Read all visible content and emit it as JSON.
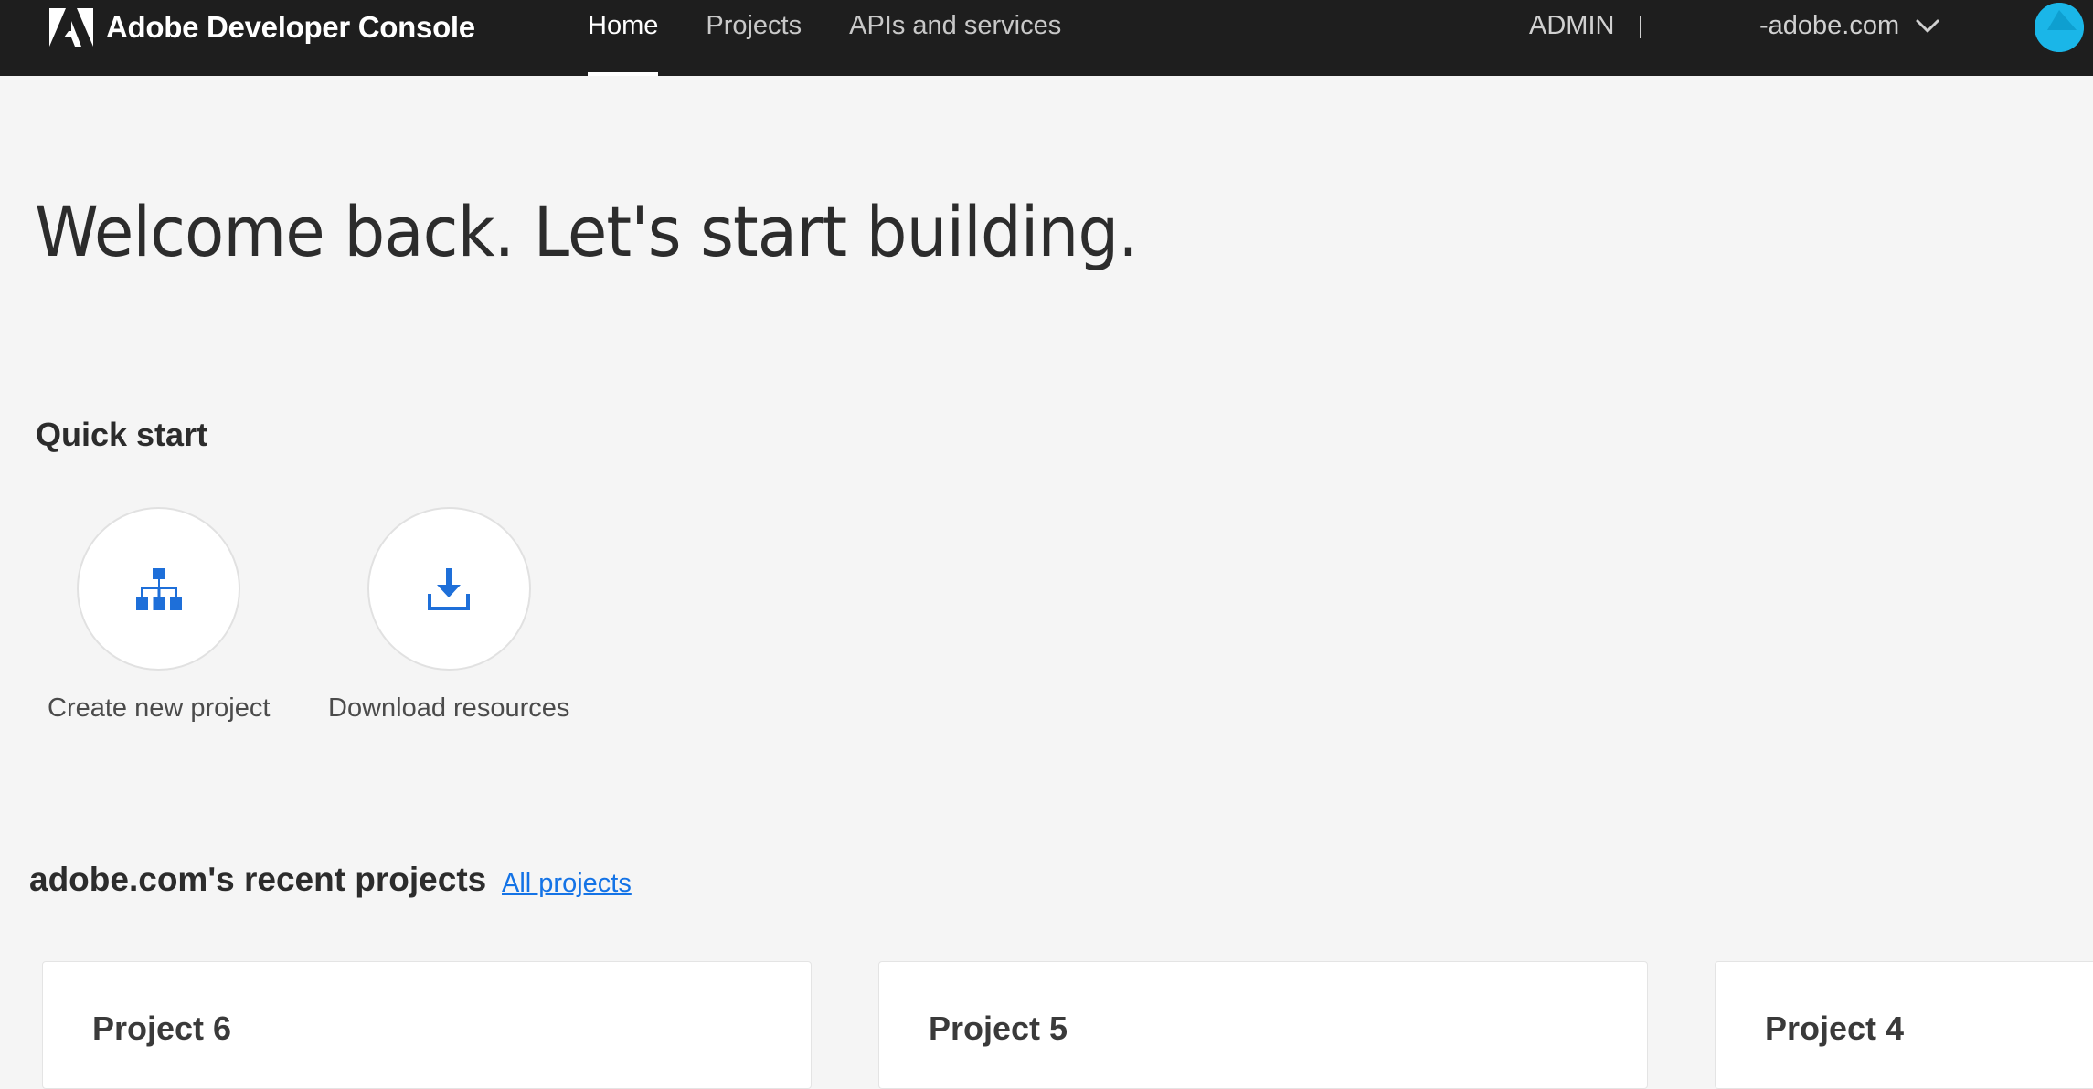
{
  "header": {
    "app_title": "Adobe Developer Console",
    "nav": [
      {
        "label": "Home",
        "active": true
      },
      {
        "label": "Projects",
        "active": false
      },
      {
        "label": "APIs and services",
        "active": false
      }
    ],
    "role": "ADMIN",
    "org": "-adobe.com",
    "icons": {
      "logo": "adobe-logo-icon",
      "org_dropdown": "chevron-down-icon",
      "avatar": "avatar"
    }
  },
  "main": {
    "welcome": "Welcome back. Let's start building.",
    "quick_start": {
      "title": "Quick start",
      "items": [
        {
          "label": "Create new project",
          "icon": "project-hierarchy-icon"
        },
        {
          "label": "Download resources",
          "icon": "download-icon"
        }
      ]
    },
    "recent": {
      "title": "adobe.com's recent projects",
      "all_link": "All projects",
      "projects": [
        {
          "name": "Project 6"
        },
        {
          "name": "Project 5"
        },
        {
          "name": "Project 4"
        }
      ]
    }
  },
  "colors": {
    "topbar_bg": "#1e1e1e",
    "page_bg": "#f5f5f5",
    "accent_blue": "#1473e6",
    "icon_blue": "#1e6fd9",
    "avatar": "#1ab6e8"
  }
}
